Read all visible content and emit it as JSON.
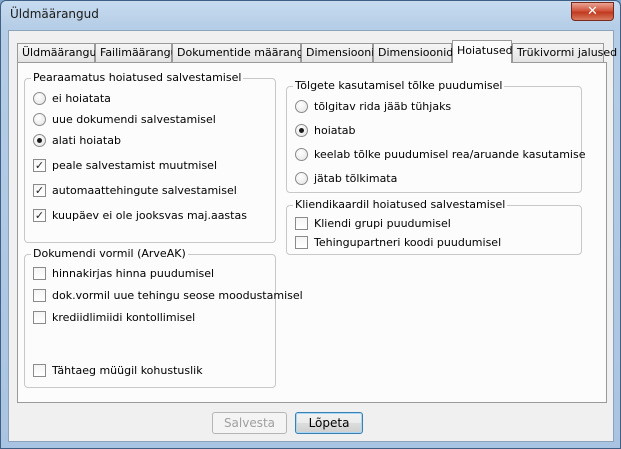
{
  "window": {
    "title": "Üldmäärangud",
    "close_glyph": "✕"
  },
  "tabs": [
    {
      "label": "Üldmäärangud"
    },
    {
      "label": "Failimäärangud"
    },
    {
      "label": "Dokumentide määrangud"
    },
    {
      "label": "Dimensioonid"
    },
    {
      "label": "DimensioonidV"
    },
    {
      "label": "Hoiatused"
    },
    {
      "label": "Trükivormi jalused"
    }
  ],
  "active_tab": "Hoiatused",
  "main_save": {
    "title": "Pearaamatus hoiatused salvestamisel",
    "radios": [
      {
        "label": "ei hoiatata",
        "checked": false
      },
      {
        "label": "uue dokumendi salvestamisel",
        "checked": false
      },
      {
        "label": "alati hoiatab",
        "checked": true
      }
    ],
    "checks": [
      {
        "label": "peale salvestamist muutmisel",
        "checked": true
      },
      {
        "label": "automaattehingute salvestamisel",
        "checked": true
      },
      {
        "label": "kuupäev ei ole jooksvas maj.aastas",
        "checked": true
      }
    ]
  },
  "doc_form": {
    "title": "Dokumendi vormil (ArveAK)",
    "checks": [
      {
        "label": "hinnakirjas hinna puudumisel",
        "checked": false
      },
      {
        "label": "dok.vormil uue tehingu seose moodustamisel",
        "checked": false
      },
      {
        "label": "krediidlimiidi kontollimisel",
        "checked": false
      },
      {
        "label": "Tähtaeg müügil kohustuslik",
        "checked": false
      }
    ]
  },
  "translation": {
    "title": "Tõlgete kasutamisel tõlke puudumisel",
    "radios": [
      {
        "label": "tõlgitav rida jääb tühjaks",
        "checked": false
      },
      {
        "label": "hoiatab",
        "checked": true
      },
      {
        "label": "keelab tõlke puudumisel rea/aruande kasutamise",
        "checked": false
      },
      {
        "label": "jätab tõlkimata",
        "checked": false
      }
    ]
  },
  "client_card": {
    "title": "Kliendikaardil hoiatused salvestamisel",
    "checks": [
      {
        "label": "Kliendi grupi puudumisel",
        "checked": false
      },
      {
        "label": "Tehingupartneri koodi puudumisel",
        "checked": false
      }
    ]
  },
  "buttons": {
    "save": "Salvesta",
    "finish": "Lõpeta"
  },
  "glyphs": {
    "checkmark": "✓"
  }
}
